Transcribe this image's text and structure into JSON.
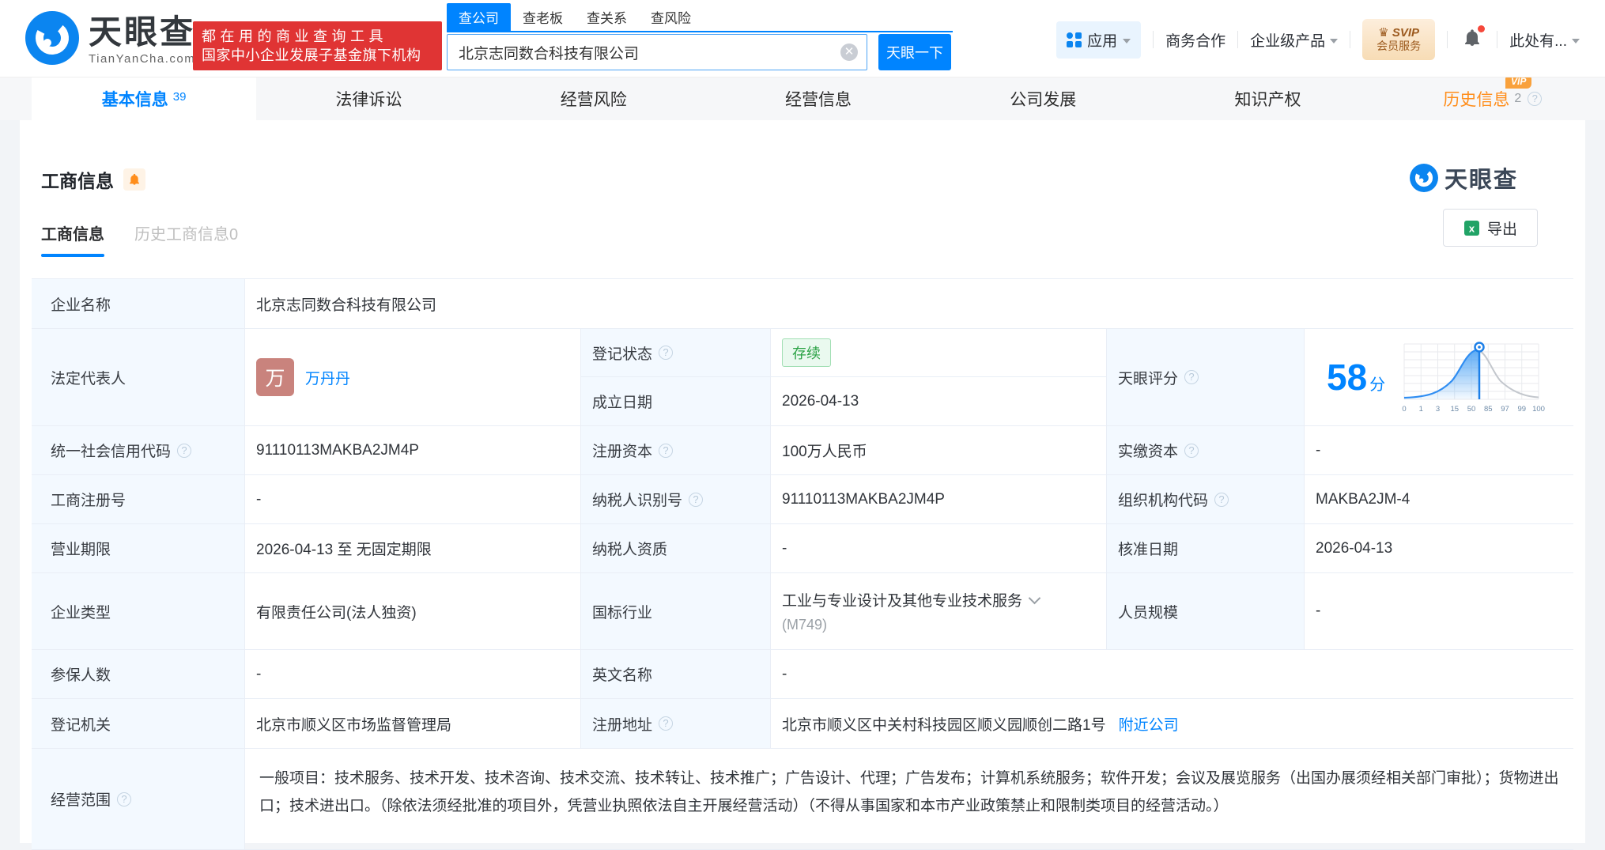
{
  "header": {
    "logo_title": "天眼查",
    "logo_domain": "TianYanCha.com",
    "slogan_line1": "都在用的商业查询工具",
    "slogan_line2": "国家中小企业发展子基金旗下机构",
    "search_tabs": [
      "查公司",
      "查老板",
      "查关系",
      "查风险"
    ],
    "search_value": "北京志同数合科技有限公司",
    "search_button": "天眼一下",
    "menu_apps": "应用",
    "menu_cooperation": "商务合作",
    "menu_enterprise": "企业级产品",
    "menu_svip_top": "SVIP",
    "menu_svip_bottom": "会员服务",
    "menu_more": "此处有..."
  },
  "nav_tabs": [
    {
      "label": "基本信息",
      "count": "39"
    },
    {
      "label": "法律诉讼"
    },
    {
      "label": "经营风险"
    },
    {
      "label": "经营信息"
    },
    {
      "label": "公司发展"
    },
    {
      "label": "知识产权"
    },
    {
      "label": "历史信息",
      "count": "2",
      "vip": "VIP"
    }
  ],
  "section": {
    "title": "工商信息",
    "watermark": "天眼查",
    "subtab_active": "工商信息",
    "subtab_history": "历史工商信息0",
    "export_label": "导出"
  },
  "info": {
    "company_name_label": "企业名称",
    "company_name": "北京志同数合科技有限公司",
    "legal_rep_label": "法定代表人",
    "legal_rep_avatar": "万",
    "legal_rep_name": "万丹丹",
    "reg_status_label": "登记状态",
    "reg_status": "存续",
    "establish_label": "成立日期",
    "establish_date": "2026-04-13",
    "score_label": "天眼评分",
    "score_value": "58",
    "score_unit": "分",
    "credit_code_label": "统一社会信用代码",
    "credit_code": "91110113MAKBA2JM4P",
    "reg_capital_label": "注册资本",
    "reg_capital": "100万人民币",
    "paid_capital_label": "实缴资本",
    "paid_capital": "-",
    "reg_number_label": "工商注册号",
    "reg_number": "-",
    "taxpayer_id_label": "纳税人识别号",
    "taxpayer_id": "91110113MAKBA2JM4P",
    "org_code_label": "组织机构代码",
    "org_code": "MAKBA2JM-4",
    "business_term_label": "营业期限",
    "business_term": "2026-04-13 至 无固定期限",
    "taxpayer_quality_label": "纳税人资质",
    "taxpayer_quality": "-",
    "approval_date_label": "核准日期",
    "approval_date": "2026-04-13",
    "company_type_label": "企业类型",
    "company_type": "有限责任公司(法人独资)",
    "industry_label": "国标行业",
    "industry": "工业与专业设计及其他专业技术服务",
    "industry_code": "(M749)",
    "staff_size_label": "人员规模",
    "staff_size": "-",
    "insured_label": "参保人数",
    "insured": "-",
    "english_name_label": "英文名称",
    "english_name": "-",
    "reg_authority_label": "登记机关",
    "reg_authority": "北京市顺义区市场监督管理局",
    "reg_address_label": "注册地址",
    "reg_address": "北京市顺义区中关村科技园区顺义园顺创二路1号",
    "nearby_link": "附近公司",
    "business_scope_label": "经营范围",
    "business_scope": "一般项目：技术服务、技术开发、技术咨询、技术交流、技术转让、技术推广；广告设计、代理；广告发布；计算机系统服务；软件开发；会议及展览服务（出国办展须经相关部门审批）；货物进出口；技术进出口。（除依法须经批准的项目外，凭营业执照依法自主开展经营活动）（不得从事国家和本市产业政策禁止和限制类项目的经营活动。）"
  },
  "score_chart": {
    "type": "area",
    "x_labels": [
      "0",
      "1",
      "3",
      "15",
      "50",
      "85",
      "97",
      "99",
      "100"
    ],
    "score": 58
  },
  "colors": {
    "brand_blue": "#0084FF",
    "slogan_red": "#E03434",
    "status_green": "#2BA245",
    "history_orange": "#FF8E1C"
  }
}
